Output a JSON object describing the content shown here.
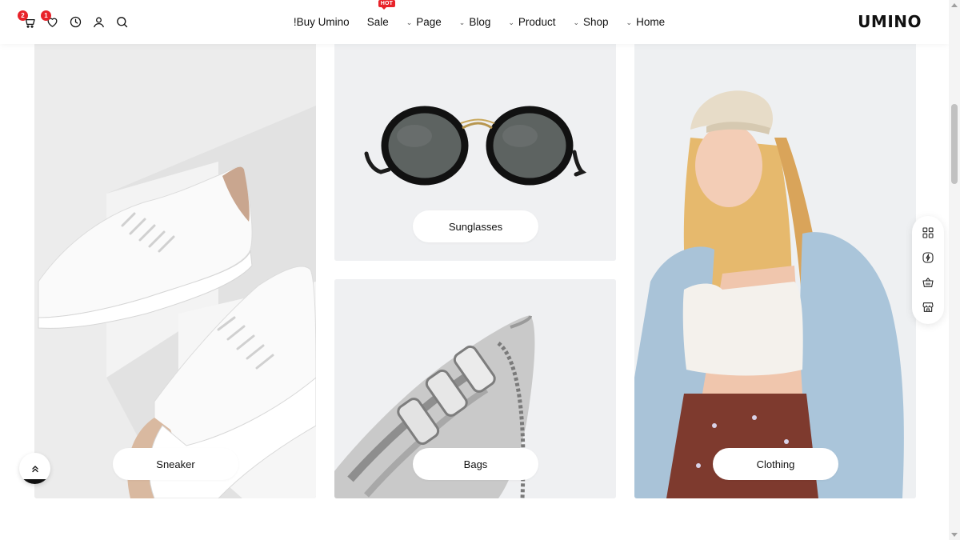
{
  "header": {
    "cart_badge": "2",
    "wishlist_badge": "1",
    "icons": [
      "cart-icon",
      "heart-icon",
      "clock-icon",
      "user-icon",
      "search-icon"
    ],
    "nav": [
      {
        "label": "!Buy Umino",
        "dropdown": false
      },
      {
        "label": "Sale",
        "dropdown": false,
        "tag": "HOT"
      },
      {
        "label": "Page",
        "dropdown": true
      },
      {
        "label": "Blog",
        "dropdown": true
      },
      {
        "label": "Product",
        "dropdown": true
      },
      {
        "label": "Shop",
        "dropdown": true
      },
      {
        "label": "Home",
        "dropdown": true
      }
    ],
    "logo": "UMINO"
  },
  "categories": [
    {
      "label": "Sneaker"
    },
    {
      "label": "Sunglasses"
    },
    {
      "label": "Bags"
    },
    {
      "label": "Clothing"
    }
  ],
  "side_tools": [
    "grid-icon",
    "lightning-icon",
    "basket-icon",
    "store-icon"
  ],
  "colors": {
    "accent": "#e8232a",
    "tile_bg": "#eff0f2",
    "text": "#111111"
  }
}
